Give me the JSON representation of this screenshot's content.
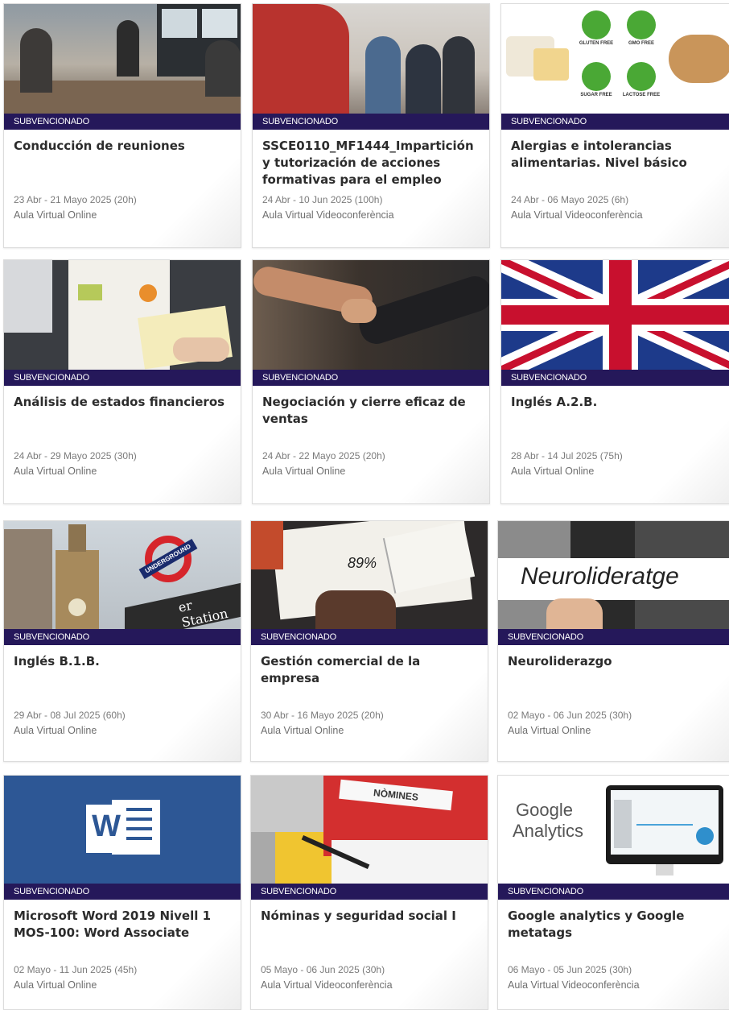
{
  "cards": [
    {
      "badge": "SUBVENCIONADO",
      "title": "Conducción de reuniones",
      "date": "23 Abr - 21 Mayo 2025 (20h)",
      "place": "Aula Virtual Online"
    },
    {
      "badge": "SUBVENCIONADO",
      "title": "SSCE0110_MF1444_Impartición y tutorización de acciones formativas para el empleo",
      "date": "24 Abr - 10 Jun 2025 (100h)",
      "place": "Aula Virtual Videoconferència"
    },
    {
      "badge": "SUBVENCIONADO",
      "title": "Alergias e intolerancias alimentarias. Nivel básico",
      "date": "24 Abr - 06 Mayo 2025 (6h)",
      "place": "Aula Virtual Videoconferència",
      "image_text": [
        "GLUTEN FREE",
        "GMO FREE",
        "SUGAR FREE",
        "LACTOSE FREE"
      ]
    },
    {
      "badge": "SUBVENCIONADO",
      "title": "Análisis de estados financieros",
      "date": "24 Abr - 29 Mayo 2025 (30h)",
      "place": "Aula Virtual Online"
    },
    {
      "badge": "SUBVENCIONADO",
      "title": "Negociación y cierre eficaz de ventas",
      "date": "24 Abr - 22 Mayo 2025 (20h)",
      "place": "Aula Virtual Online"
    },
    {
      "badge": "SUBVENCIONADO",
      "title": "Inglés A.2.B.",
      "date": "28 Abr - 14 Jul 2025 (75h)",
      "place": "Aula Virtual Online"
    },
    {
      "badge": "SUBVENCIONADO",
      "title": "Inglés B.1.B.",
      "date": "29 Abr - 08 Jul 2025 (60h)",
      "place": "Aula Virtual Online",
      "image_text": [
        "UNDERGROUND",
        "er Station"
      ]
    },
    {
      "badge": "SUBVENCIONADO",
      "title": "Gestión comercial de la empresa",
      "date": "30 Abr - 16 Mayo 2025 (20h)",
      "place": "Aula Virtual Online",
      "image_text": [
        "89%"
      ]
    },
    {
      "badge": "SUBVENCIONADO",
      "title": "Neuroliderazgo",
      "date": "02 Mayo - 06 Jun 2025 (30h)",
      "place": "Aula Virtual Online",
      "image_text": [
        "Neurolideratge"
      ]
    },
    {
      "badge": "SUBVENCIONADO",
      "title": "Microsoft Word 2019 Nivell 1 MOS-100: Word Associate",
      "date": "02 Mayo - 11 Jun 2025 (45h)",
      "place": "Aula Virtual Online",
      "image_text": [
        "W"
      ]
    },
    {
      "badge": "SUBVENCIONADO",
      "title": "Nóminas y seguridad social I",
      "date": "05 Mayo - 06 Jun 2025 (30h)",
      "place": "Aula Virtual Videoconferència",
      "image_text": [
        "NÒMINES"
      ]
    },
    {
      "badge": "SUBVENCIONADO",
      "title": "Google analytics y Google metatags",
      "date": "06 Mayo - 05 Jun 2025 (30h)",
      "place": "Aula Virtual Videoconferència",
      "image_text": [
        "Google",
        "Analytics"
      ]
    }
  ],
  "colors": {
    "badge_bg": "#25185a",
    "title": "#2c2c2c",
    "meta": "#7b7b7b"
  }
}
